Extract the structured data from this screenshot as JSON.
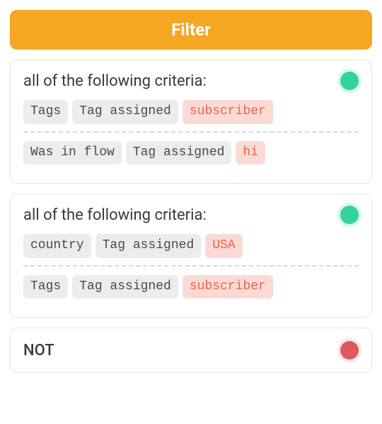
{
  "header": {
    "title": "Filter"
  },
  "groups": [
    {
      "title": "all of the following criteria:",
      "status": "green",
      "rows": [
        [
          {
            "text": "Tags",
            "style": "gray"
          },
          {
            "text": "Tag assigned",
            "style": "gray"
          },
          {
            "text": "subscriber",
            "style": "red"
          }
        ],
        [
          {
            "text": "Was in flow",
            "style": "gray"
          },
          {
            "text": "Tag assigned",
            "style": "gray"
          },
          {
            "text": "hi",
            "style": "red"
          }
        ]
      ]
    },
    {
      "title": "all of the following criteria:",
      "status": "green",
      "rows": [
        [
          {
            "text": "country",
            "style": "gray"
          },
          {
            "text": "Tag assigned",
            "style": "gray"
          },
          {
            "text": "USA",
            "style": "red"
          }
        ],
        [
          {
            "text": "Tags",
            "style": "gray"
          },
          {
            "text": "Tag assigned",
            "style": "gray"
          },
          {
            "text": "subscriber",
            "style": "red"
          }
        ]
      ]
    }
  ],
  "not_group": {
    "label": "NOT",
    "status": "red"
  }
}
